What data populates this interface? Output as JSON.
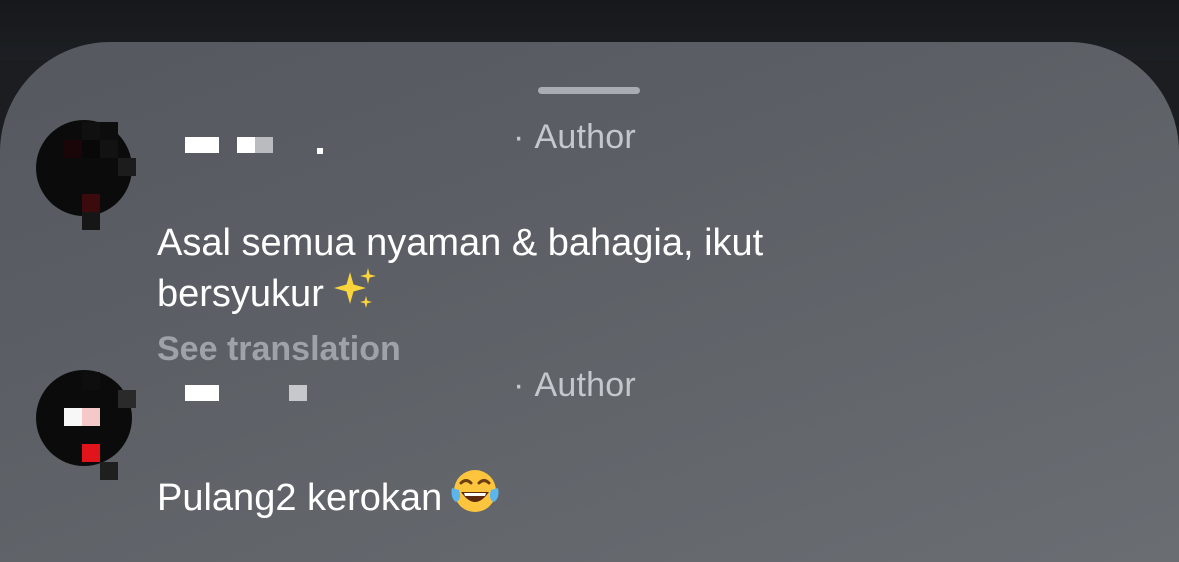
{
  "comments": [
    {
      "badge": "Author",
      "separator": "·",
      "text": "Asal semua nyaman & bahagia, ikut bersyukur",
      "emoji": "sparkles-emoji",
      "see_translation": "See translation"
    },
    {
      "badge": "Author",
      "separator": "·",
      "text": "Pulang2 kerokan",
      "emoji": "tears-of-joy-emoji"
    }
  ],
  "colors": {
    "sheet_background": "#5b5f65",
    "comment_text": "#ffffff",
    "author_label": "#c4c7cc",
    "see_translation": "#9fa3a9"
  }
}
